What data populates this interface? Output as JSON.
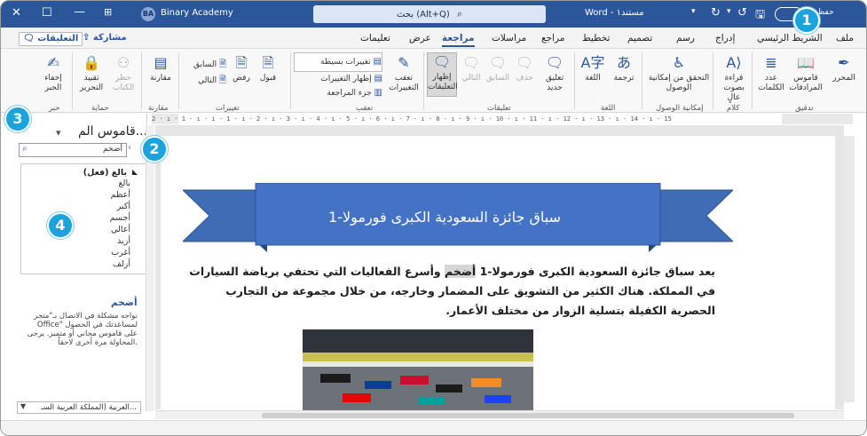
{
  "titlebar": {
    "account_initials": "BA",
    "account_name": "Binary Academy",
    "search_text": "بحث (Alt+Q)",
    "doc_title": "Word - مستند١",
    "autosave_label": "حفظ"
  },
  "tabs": [
    "ملف",
    "الشريط الرئيسي",
    "إدراج",
    "رسم",
    "تصميم",
    "تخطيط",
    "مراجع",
    "مراسلات",
    "مراجعة",
    "عرض",
    "تعليمات"
  ],
  "active_tab": "مراجعة",
  "toolbar": {
    "share_label": "مشاركة",
    "comments_label": "التعليقات"
  },
  "ribbon": {
    "proofing": {
      "editor": "المحرر",
      "thesaurus": "قاموس المرادفات",
      "word_count": "عدد الكلمات",
      "label": "تدقيق"
    },
    "speech": {
      "read_aloud": "قراءة بصوت عالٍ",
      "label": "كلام"
    },
    "accessibility": {
      "check": "التحقق من إمكانية الوصول",
      "label": "إمكانية الوصول"
    },
    "language": {
      "translate": "ترجمة",
      "language": "اللغة",
      "label": "اللغة"
    },
    "comments": {
      "new": "تعليق جديد",
      "delete": "حذف",
      "previous": "السابق",
      "next": "التالي",
      "show": "إظهار التعليقات",
      "label": "تعليقات"
    },
    "tracking": {
      "track": "تعقب التغييرات",
      "simple_markup": "تغييرات بسيطة",
      "show_markup": "إظهار التغييرات",
      "review_pane": "جزء المراجعة",
      "label": "تعقب"
    },
    "changes": {
      "accept": "قبول",
      "reject": "رفض",
      "previous": "السابق",
      "next": "التالي",
      "label": "تغييرات"
    },
    "compare": {
      "compare": "مقارنة",
      "label": "مقارنة"
    },
    "protect": {
      "block": "حظر الكتاب",
      "restrict": "تقييد التحرير",
      "label": "حماية"
    },
    "ink": {
      "hide": "إخفاء الحبر",
      "label": "حبر"
    }
  },
  "thesaurus_pane": {
    "title": "قاموس الم...",
    "search_value": "أضخم",
    "heading": "بالغ (فعل)",
    "synonyms": [
      "بالغ",
      "أعظم",
      "أكبر",
      "أجسم",
      "أعالي",
      "أزيد",
      "أغرب",
      "أزلف"
    ],
    "definition_word": "أضخم",
    "definition_text": "نواجه مشكلة في الاتصال بـ\"متجر Office\" لمساعدتك في الحصول على قاموس مجاني أو متميز. يرجى المحاولة مرة أخرى لاحقاً.",
    "language": "العربية (المملكة العربية السـ..."
  },
  "document": {
    "banner_title": "سباق جائزة السعودية الكبرى فورمولا-1",
    "para_before": "يعد سباق جائزة السعودية الكبرى فورمولا-1 ",
    "highlighted_word": "أضخم",
    "para_after": " وأسرع الفعاليات التي تحتفي برياضة السيارات في المملكة. هناك الكثير من التشويق على المضمار وخارجه، من خلال مجموعة من التجارب الحصرية الكفيلة بتسلية الزوار من مختلف الأعمار."
  },
  "ruler_text": "2 · ı · 1 · ı · ı · 1 · ı · 2 · ı · 3 · ı · 4 · ı · 5 · ı · 6 · ı · 7 · ı · 8 · ı · 9 · ı · 10 · ı · 11 · ı · 12 · ı · 13 · ı · 14 · ı · 15",
  "callouts": [
    "1",
    "2",
    "3",
    "4"
  ],
  "colors": {
    "accent": "#2b579a",
    "callout": "#1aa3dc",
    "banner": "#3f6cb5"
  }
}
